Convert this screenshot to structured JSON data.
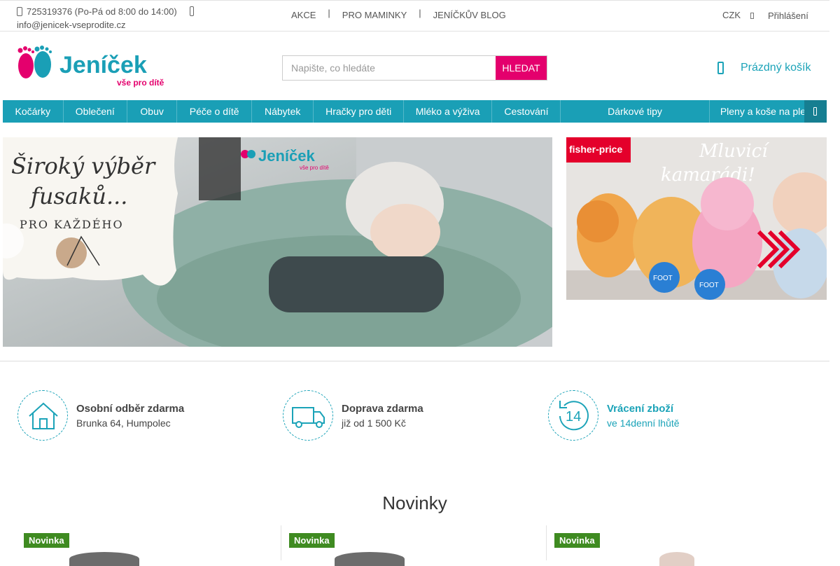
{
  "topbar": {
    "phone": "725319376 (Po-Pá od 8:00 do 14:00)",
    "email": "info@jenicek-vseprodite.cz",
    "links": [
      "AKCE",
      "PRO MAMINKY",
      "JENÍČKŮV BLOG"
    ],
    "currency": "CZK",
    "login": "Přihlášení"
  },
  "logo": {
    "name": "Jeníček",
    "tagline": "vše pro dítě"
  },
  "search": {
    "placeholder": "Napište, co hledáte",
    "button": "HLEDAT"
  },
  "cart": {
    "label": "Prázdný košík"
  },
  "mainnav": [
    "Kočárky",
    "Oblečení",
    "Obuv",
    "Péče o dítě",
    "Nábytek",
    "Hračky pro děti",
    "Mléko a výživa",
    "Cestování",
    "Dárkové tipy",
    "Pleny a koše na pleny"
  ],
  "hero": {
    "line1": "Široký výběr",
    "line2": "fusaků...",
    "line3": "PRO KAŽDÉHO",
    "logo_name": "Jeníček",
    "logo_tagline": "vše pro dítě"
  },
  "side_banner": {
    "brand": "fisher-price",
    "line1": "Mluvicí",
    "line2": "kamarádi!",
    "foot1": "FOOT",
    "foot2": "FOOT"
  },
  "benefits": [
    {
      "title": "Osobní odběr zdarma",
      "sub": "Brunka 64, Humpolec",
      "icon": "house-icon"
    },
    {
      "title": "Doprava zdarma",
      "sub": "již od 1 500 Kč",
      "icon": "truck-icon"
    },
    {
      "title": "Vrácení zboží",
      "sub": "ve 14denní lhůtě",
      "icon": "return-14-icon",
      "badge_number": "14"
    }
  ],
  "novinky": {
    "title": "Novinky",
    "badges": [
      "Novinka",
      "Novinka",
      "Novinka"
    ]
  },
  "colors": {
    "brand_pink": "#e4006d",
    "brand_teal": "#1a9fb6",
    "badge_green": "#3f8b21"
  }
}
